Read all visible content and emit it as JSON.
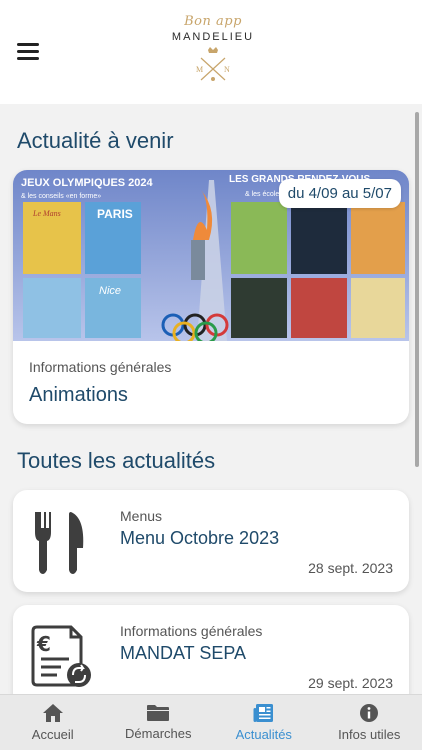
{
  "header": {
    "menu_icon": "hamburger-menu-icon",
    "logo_script": "Bon app",
    "logo_name": "MANDELIEU",
    "logo_initials": "M N"
  },
  "upcoming": {
    "section_title": "Actualité à venir",
    "card": {
      "date_range": "du 4/09 au 5/07",
      "category": "Informations générales",
      "title": "Animations",
      "image_texts": [
        "JEUX OLYMPIQUES 2024",
        "& les conseils «en forme»",
        "LES GRANDS RENDEZ-VOUS",
        "& les écoles",
        "PARIS",
        "Nice",
        "Le Mans"
      ]
    }
  },
  "all_news": {
    "section_title": "Toutes les actualités",
    "items": [
      {
        "icon": "fork-knife-icon",
        "category": "Menus",
        "title": "Menu Octobre 2023",
        "date": "28 sept. 2023"
      },
      {
        "icon": "euro-document-icon",
        "category": "Informations générales",
        "title": "MANDAT SEPA",
        "date": "29 sept. 2023"
      }
    ]
  },
  "tabs": [
    {
      "label": "Accueil",
      "icon": "home-icon",
      "active": false
    },
    {
      "label": "Démarches",
      "icon": "folder-icon",
      "active": false
    },
    {
      "label": "Actualités",
      "icon": "newspaper-icon",
      "active": true
    },
    {
      "label": "Infos utiles",
      "icon": "info-icon",
      "active": false
    }
  ],
  "colors": {
    "primary_text": "#1f4a6a",
    "active_tab": "#3a8fd0",
    "logo_gold": "#c8a56b"
  }
}
